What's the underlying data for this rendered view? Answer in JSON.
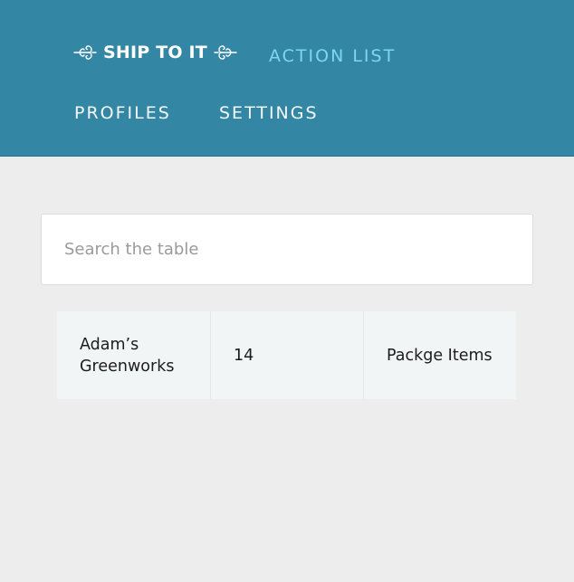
{
  "header": {
    "background": "#3387a5",
    "logo": {
      "text": "SHIP TO IT",
      "left_icon": "flourish-left-icon",
      "right_icon": "flourish-right-icon"
    },
    "nav": {
      "action_list": "ACTION LIST",
      "profiles": "PROFILES",
      "settings": "SETTINGS"
    },
    "active_color": "#7fd6f4"
  },
  "search": {
    "placeholder": "Search the table",
    "value": ""
  },
  "table": {
    "rows": [
      {
        "name": "Adam’s Greenworks",
        "count": "14",
        "items": "Packge Items"
      }
    ]
  }
}
